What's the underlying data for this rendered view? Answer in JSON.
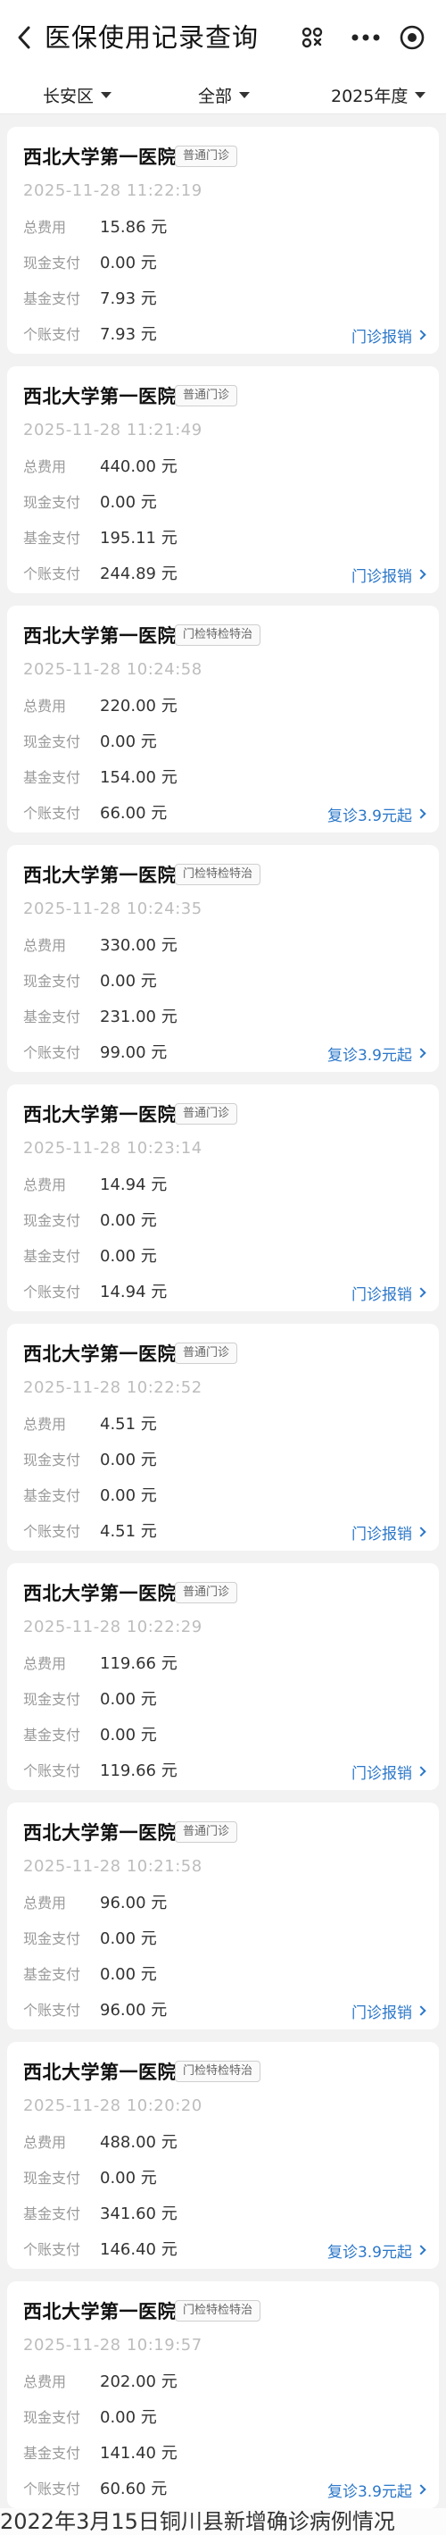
{
  "header": {
    "title": "医保使用记录查询",
    "back_icon": "chevron-left-icon",
    "scan_icon": "scan-icon",
    "more_icon": "more-dots-icon",
    "target_icon": "target-icon"
  },
  "filters": {
    "district": "长安区",
    "type": "全部",
    "year": "2025年度"
  },
  "labels": {
    "total": "总费用",
    "cash": "现金支付",
    "fund": "基金支付",
    "personal": "个账支付"
  },
  "records": [
    {
      "hospital": "西北大学第一医院",
      "badge": "普通门诊",
      "time": "2025-11-28 11:22:19",
      "total": "15.86 元",
      "cash": "0.00 元",
      "fund": "7.93 元",
      "personal": "7.93 元",
      "action": "门诊报销"
    },
    {
      "hospital": "西北大学第一医院",
      "badge": "普通门诊",
      "time": "2025-11-28 11:21:49",
      "total": "440.00 元",
      "cash": "0.00 元",
      "fund": "195.11 元",
      "personal": "244.89 元",
      "action": "门诊报销"
    },
    {
      "hospital": "西北大学第一医院",
      "badge": "门检特检特治",
      "time": "2025-11-28 10:24:58",
      "total": "220.00 元",
      "cash": "0.00 元",
      "fund": "154.00 元",
      "personal": "66.00 元",
      "action": "复诊3.9元起"
    },
    {
      "hospital": "西北大学第一医院",
      "badge": "门检特检特治",
      "time": "2025-11-28 10:24:35",
      "total": "330.00 元",
      "cash": "0.00 元",
      "fund": "231.00 元",
      "personal": "99.00 元",
      "action": "复诊3.9元起"
    },
    {
      "hospital": "西北大学第一医院",
      "badge": "普通门诊",
      "time": "2025-11-28 10:23:14",
      "total": "14.94 元",
      "cash": "0.00 元",
      "fund": "0.00 元",
      "personal": "14.94 元",
      "action": "门诊报销"
    },
    {
      "hospital": "西北大学第一医院",
      "badge": "普通门诊",
      "time": "2025-11-28 10:22:52",
      "total": "4.51 元",
      "cash": "0.00 元",
      "fund": "0.00 元",
      "personal": "4.51 元",
      "action": "门诊报销"
    },
    {
      "hospital": "西北大学第一医院",
      "badge": "普通门诊",
      "time": "2025-11-28 10:22:29",
      "total": "119.66 元",
      "cash": "0.00 元",
      "fund": "0.00 元",
      "personal": "119.66 元",
      "action": "门诊报销"
    },
    {
      "hospital": "西北大学第一医院",
      "badge": "普通门诊",
      "time": "2025-11-28 10:21:58",
      "total": "96.00 元",
      "cash": "0.00 元",
      "fund": "0.00 元",
      "personal": "96.00 元",
      "action": "门诊报销"
    },
    {
      "hospital": "西北大学第一医院",
      "badge": "门检特检特治",
      "time": "2025-11-28 10:20:20",
      "total": "488.00 元",
      "cash": "0.00 元",
      "fund": "341.60 元",
      "personal": "146.40 元",
      "action": "复诊3.9元起"
    },
    {
      "hospital": "西北大学第一医院",
      "badge": "门检特检特治",
      "time": "2025-11-28 10:19:57",
      "total": "202.00 元",
      "cash": "0.00 元",
      "fund": "141.40 元",
      "personal": "60.60 元",
      "action": "复诊3.9元起"
    }
  ],
  "caption": "2022年3月15日铜川县新增确诊病例情况",
  "colors": {
    "accent": "#2b77c9",
    "background": "#f2f2f2",
    "card": "#ffffff",
    "muted": "#9a9a9a"
  }
}
